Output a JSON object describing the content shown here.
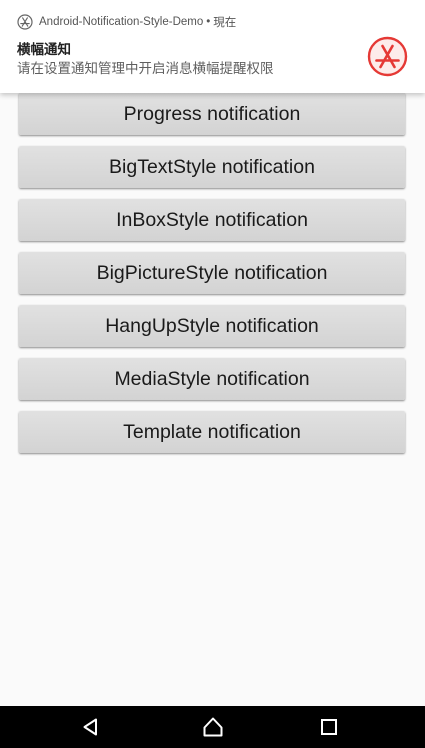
{
  "notification": {
    "app_name": "Android-Notification-Style-Demo",
    "separator": "•",
    "time": "現在",
    "title": "横幅通知",
    "text": "请在设置通知管理中开启消息横幅提醒权限",
    "small_icon": "app-store-icon",
    "large_icon": "app-store-icon",
    "accent_color": "#e53935"
  },
  "buttons": [
    {
      "label": "Progress notification"
    },
    {
      "label": "BigTextStyle notification"
    },
    {
      "label": "InBoxStyle notification"
    },
    {
      "label": "BigPictureStyle notification"
    },
    {
      "label": "HangUpStyle notification"
    },
    {
      "label": "MediaStyle notification"
    },
    {
      "label": "Template notification"
    }
  ],
  "navbar": {
    "back_icon": "back-triangle-icon",
    "home_icon": "home-circle-icon",
    "recents_icon": "recents-square-icon"
  }
}
